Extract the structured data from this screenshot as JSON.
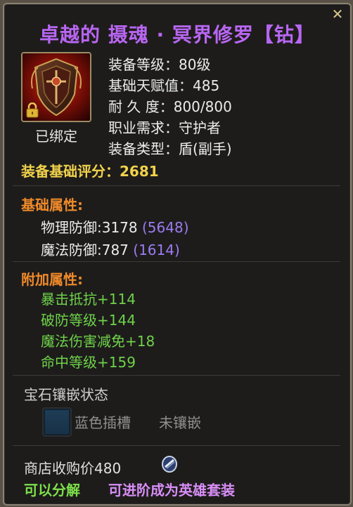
{
  "item": {
    "title": "卓越的 摄魂 · 冥界修罗【钻】",
    "bound_label": "已绑定",
    "stats": [
      {
        "label": "装备等级：",
        "value": "80级"
      },
      {
        "label": "基础天赋值：",
        "value": "485"
      },
      {
        "label": "耐 久 度：",
        "value": "800/800"
      },
      {
        "label": "职业需求：",
        "value": "守护者"
      },
      {
        "label": "装备类型：",
        "value": "盾(副手)"
      }
    ],
    "score_label": "装备基础评分：",
    "score_value": "2681"
  },
  "base_attributes": {
    "heading": "基础属性:",
    "items": [
      {
        "label": "物理防御:3178",
        "max": "(5648)"
      },
      {
        "label": "魔法防御:787",
        "max": "(1614)"
      }
    ]
  },
  "extra_attributes": {
    "heading": "附加属性:",
    "items": [
      "暴击抵抗+114",
      "破防等级+144",
      "魔法伤害减免+18",
      "命中等级+159"
    ]
  },
  "gems": {
    "heading": "宝石镶嵌状态",
    "slot_label": "蓝色插槽",
    "slot_state": "未镶嵌"
  },
  "footer": {
    "shop_price": "商店收购价480",
    "tradable": "可以分解",
    "upgrade": "可进阶成为英雄套装"
  },
  "icons": {
    "close": "close-icon",
    "item": "shield-item-icon",
    "lock": "lock-icon",
    "currency": "coin-icon"
  },
  "colors": {
    "title": "#b866f2",
    "section": "#f08a2a",
    "score": "#f1d24b",
    "bonus": "#6fd24a",
    "upgrade": "#d98ef7"
  }
}
